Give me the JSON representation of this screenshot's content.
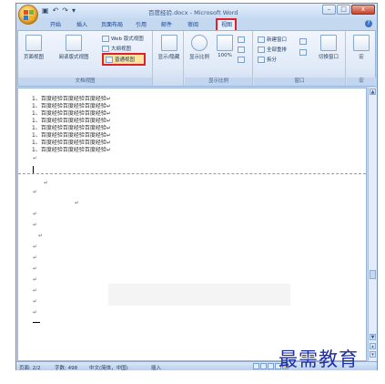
{
  "window": {
    "title": "百度经验.docx - Microsoft Word"
  },
  "qat": {
    "save": "▣",
    "undo": "↶",
    "redo": "↷",
    "more": "▾"
  },
  "tabs": [
    {
      "label": "开始"
    },
    {
      "label": "插入"
    },
    {
      "label": "页面布局"
    },
    {
      "label": "引用"
    },
    {
      "label": "邮件"
    },
    {
      "label": "审阅"
    },
    {
      "label": "视图",
      "active": true
    }
  ],
  "controls": {
    "minimize": "–",
    "maximize": "□",
    "close": "x",
    "help": "?"
  },
  "ribbon": {
    "doc_views": {
      "label": "文档视图",
      "print_layout": "页面视图",
      "full_screen_reading": "阅读版式视图",
      "web_layout": "Web 版式视图",
      "outline": "大纲视图",
      "draft": "普通视图"
    },
    "show_hide": {
      "label": "显示/隐藏"
    },
    "zoom": {
      "label": "显示比例",
      "zoom_btn": "显示比例",
      "hundred": "100%"
    },
    "window": {
      "label": "窗口",
      "new_window": "新建窗口",
      "arrange_all": "全部重排",
      "split": "拆分",
      "switch": "切换窗口"
    },
    "macros": {
      "label": "宏",
      "btn": "宏"
    }
  },
  "document": {
    "lines": [
      "1、百度经验百度经验百度经验↵",
      "1、百度经验百度经验百度经验↵",
      "1、百度经验百度经验百度经验↵",
      "1、百度经验百度经验百度经验↵",
      "1、百度经验百度经验百度经验↵",
      "1、百度经验百度经验百度经验↵",
      "1、百度经验百度经验百度经验↵",
      "1、百度经验百度经验百度经验↵"
    ],
    "para_mark": "↵"
  },
  "status": {
    "page": "页面: 2/2",
    "words": "字数: 498",
    "language": "中文(简体，中国)",
    "mode": "插入"
  },
  "watermark": "最需教育"
}
